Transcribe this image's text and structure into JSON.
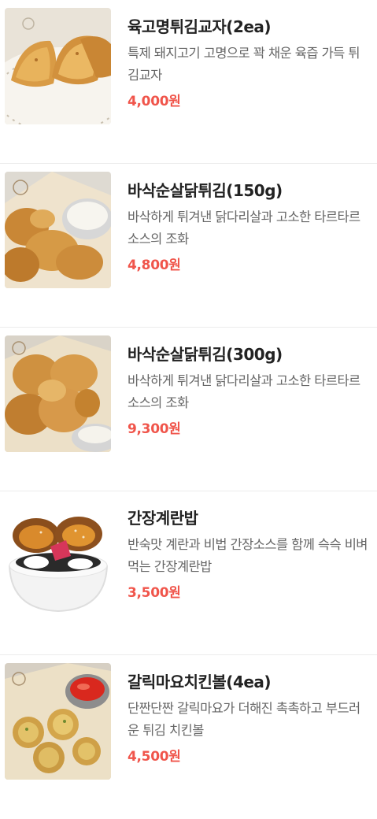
{
  "menu": {
    "items": [
      {
        "name": "육고명튀김교자(2ea)",
        "description": "특제 돼지고기 고명으로 꽉 채운 육즙 가득 튀김교자",
        "price": "4,000원",
        "image_icon": "fried-dumpling-photo"
      },
      {
        "name": "바삭순살닭튀김(150g)",
        "description": "바삭하게 튀겨낸 닭다리살과 고소한 타르타르소스의 조화",
        "price": "4,800원",
        "image_icon": "fried-chicken-small-photo"
      },
      {
        "name": "바삭순살닭튀김(300g)",
        "description": "바삭하게 튀겨낸 닭다리살과 고소한 타르타르소스의 조화",
        "price": "9,300원",
        "image_icon": "fried-chicken-large-photo"
      },
      {
        "name": "간장계란밥",
        "description": "반숙맛 계란과 비법 간장소스를 함께 슥슥 비벼 먹는 간장계란밥",
        "price": "3,500원",
        "image_icon": "soy-egg-rice-photo"
      },
      {
        "name": "갈릭마요치킨볼(4ea)",
        "description": "단짠단짠 갈릭마요가 더해진 촉촉하고 부드러운 튀김 치킨볼",
        "price": "4,500원",
        "image_icon": "chicken-ball-photo"
      }
    ]
  },
  "colors": {
    "price": "#f0554b",
    "title": "#222222",
    "description": "#666666",
    "divider": "#ececec"
  }
}
